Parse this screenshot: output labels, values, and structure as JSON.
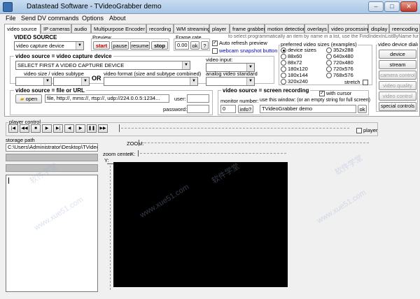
{
  "window": {
    "title": "Datastead Software - TVideoGrabber demo",
    "min": "–",
    "max": "□",
    "close": "✕"
  },
  "menu": [
    "File",
    "Send DV commands",
    "Options",
    "About"
  ],
  "tabs": [
    "video source",
    "IP cameras",
    "audio",
    "Multipurpose Encoder",
    "recording",
    "WM streaming",
    "player",
    "frame grabber",
    "motion detection",
    "overlays",
    "video processing",
    "display",
    "reencoding"
  ],
  "hint": "to select programmatically an item by name in a list, use the FindIndexInListByName func",
  "video_source": {
    "label": "VIDEO SOURCE",
    "value": "video capture device"
  },
  "preview": {
    "label": "Preview",
    "start": "start",
    "pause": "pause",
    "resume": "resume",
    "stop": "stop"
  },
  "frame_rate": {
    "label": "Frame rate",
    "value": "0.00",
    "ok": "ok",
    "help": "?"
  },
  "auto_refresh": {
    "label": "Auto refresh preview",
    "checked": true
  },
  "webcam_snapshot": {
    "label": "webcam snapshot button",
    "checked": false
  },
  "capture_device": {
    "header": "video source = video capture device",
    "select_value": "SELECT FIRST A VIDEO CAPTURE DEVICE",
    "video_input_label": "video input:",
    "size_label": "video size / video subtype",
    "or_label": "OR",
    "format_label": "video format (size and subtype combined)",
    "analog_label": "analog video standard"
  },
  "file_source": {
    "header": "video source = file or URL",
    "open": "open",
    "url_value": "file, http://, mms://, rtsp://, udp://224.0.0.5:1234...",
    "user_label": "user:",
    "password_label": "password:"
  },
  "screen_recording": {
    "header": "video source = screen recording",
    "with_cursor": "with cursor",
    "monitor_label": "monitor number:",
    "monitor_value": "0",
    "info": "info?",
    "window_label": "use this window: (or an empty string for full screen)",
    "window_value": "TVideoGrabber demo",
    "ok": "ok"
  },
  "preferred_sizes": {
    "label": "preferred video sizes (examples)",
    "col1": [
      "device sizes",
      "88x60",
      "88x72",
      "180x120",
      "180x144",
      "320x240"
    ],
    "col2": [
      "352x288",
      "640x480",
      "720x480",
      "720x576",
      "768x576"
    ],
    "selected": "device sizes",
    "stretch": "stretch"
  },
  "device_dialogs": {
    "label": "video device dialo",
    "buttons": [
      "device",
      "stream",
      "camera control",
      "video quality",
      "video control",
      "special controls"
    ],
    "disabled": [
      "camera control",
      "video quality",
      "video control"
    ]
  },
  "player_control": {
    "label": "player control",
    "buttons": [
      "|◀",
      "◀◀",
      "■",
      "▶",
      "▶|",
      "◀",
      "▶",
      "❚❚",
      "▶▶",
      "▶▶|"
    ],
    "player_checkbox": "player"
  },
  "storage": {
    "label": "storage path",
    "value": "C:\\Users\\Administrator\\Desktop\\TVideoG"
  },
  "zoom": {
    "zoom_label": "ZOOM:",
    "zoom_center_label": "zoom center",
    "x_label": "X:",
    "y_label": "Y:"
  },
  "watermarks": [
    "软件学堂",
    "www.xue51.com",
    "软件学堂",
    "www.xue51.com",
    "软件学堂",
    "www.xue51.com"
  ]
}
